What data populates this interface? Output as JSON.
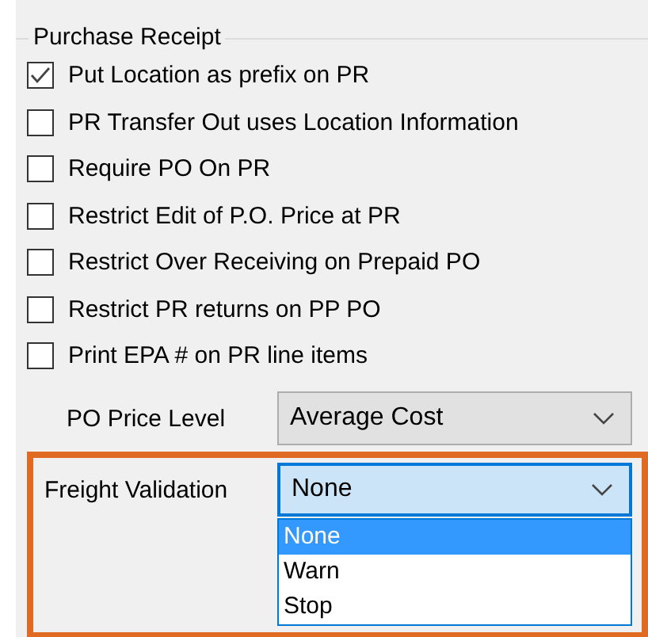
{
  "group": {
    "title": "Purchase Receipt"
  },
  "options": [
    {
      "label": "Put Location as prefix on PR",
      "checked": true
    },
    {
      "label": "PR Transfer Out uses Location Information",
      "checked": false
    },
    {
      "label": "Require PO On PR",
      "checked": false
    },
    {
      "label": "Restrict Edit of P.O. Price at PR",
      "checked": false
    },
    {
      "label": "Restrict Over Receiving on Prepaid PO",
      "checked": false
    },
    {
      "label": "Restrict PR returns on PP PO",
      "checked": false
    },
    {
      "label": "Print EPA # on PR line items",
      "checked": false
    }
  ],
  "fields": [
    {
      "label": "PO Price Level",
      "value": "Average Cost",
      "focused": false
    },
    {
      "label": "Freight Validation",
      "value": "None",
      "focused": true,
      "highlighted": true,
      "options": [
        {
          "label": "None",
          "selected": true
        },
        {
          "label": "Warn",
          "selected": false
        },
        {
          "label": "Stop",
          "selected": false
        }
      ]
    }
  ]
}
